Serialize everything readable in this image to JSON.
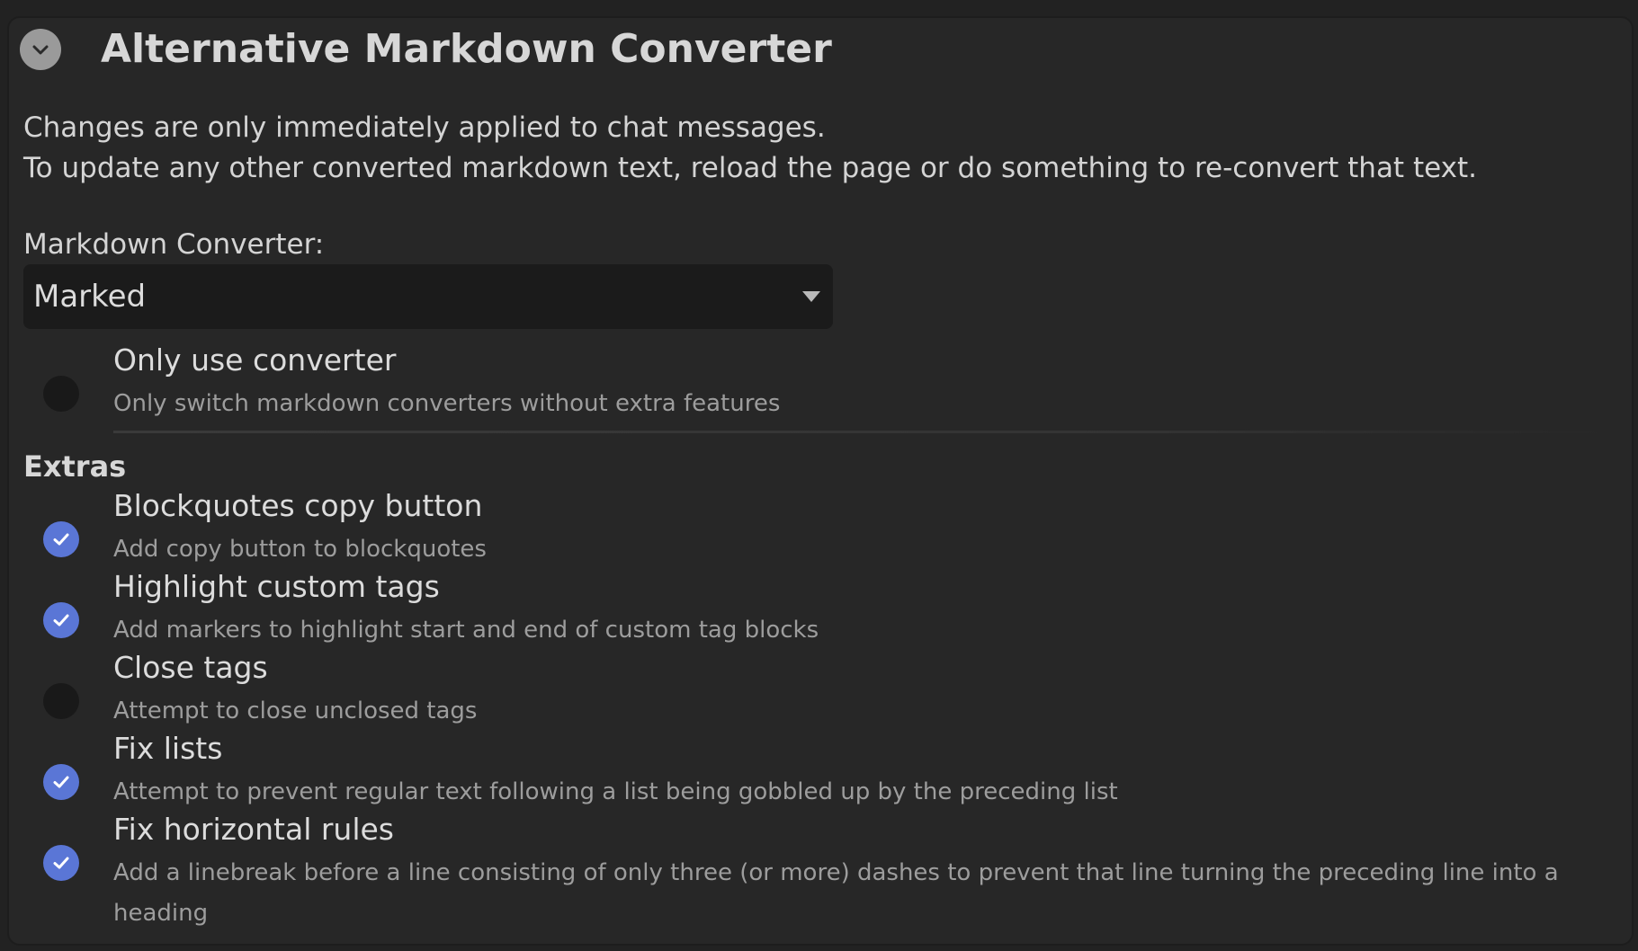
{
  "header": {
    "title": "Alternative Markdown Converter",
    "collapse_icon": "chevron-down-icon"
  },
  "info": {
    "line1": "Changes are only immediately applied to chat messages.",
    "line2": "To update any other converted markdown text, reload the page or do something to re-convert that text."
  },
  "converter": {
    "label": "Markdown Converter:",
    "selected": "Marked"
  },
  "only_use": {
    "title": "Only use converter",
    "description": "Only switch markdown converters without extra features",
    "checked": false
  },
  "extras": {
    "heading": "Extras",
    "items": [
      {
        "title": "Blockquotes copy button",
        "description": "Add copy button to blockquotes",
        "checked": true
      },
      {
        "title": "Highlight custom tags",
        "description": "Add markers to highlight start and end of custom tag blocks",
        "checked": true
      },
      {
        "title": "Close tags",
        "description": "Attempt to close unclosed tags",
        "checked": false
      },
      {
        "title": "Fix lists",
        "description": "Attempt to prevent regular text following a list being gobbled up by the preceding list",
        "checked": true
      },
      {
        "title": "Fix horizontal rules",
        "description": "Add a linebreak before a line consisting of only three (or more) dashes to prevent that line turning the preceding line into a heading",
        "checked": true
      }
    ]
  },
  "colors": {
    "background": "#222222",
    "panel": "#272727",
    "accent": "#5a76d6",
    "text": "#d6d6d6",
    "muted_text": "#9d9d9d"
  }
}
